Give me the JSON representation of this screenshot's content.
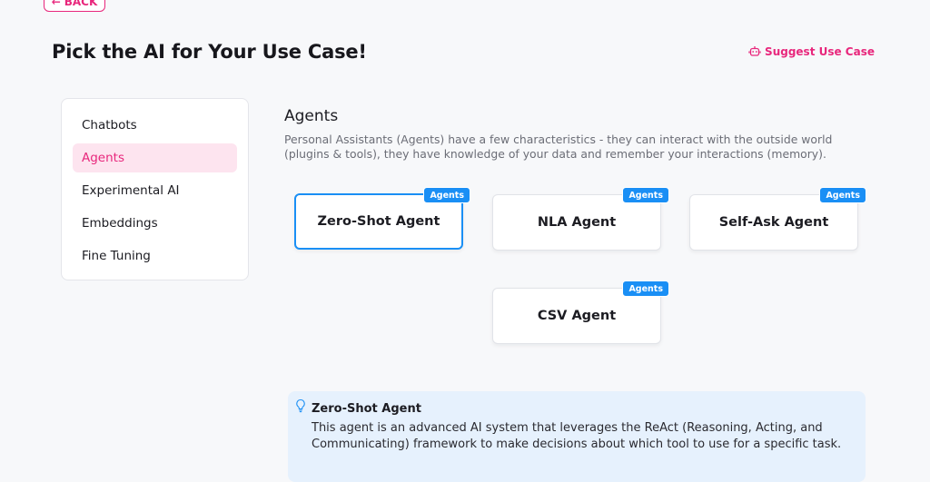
{
  "header": {
    "back_label": "BACK",
    "title": "Pick the AI for Your Use Case!",
    "suggest_label": "Suggest Use Case"
  },
  "sidebar": {
    "items": [
      {
        "label": "Chatbots",
        "active": false
      },
      {
        "label": "Agents",
        "active": true
      },
      {
        "label": "Experimental AI",
        "active": false
      },
      {
        "label": "Embeddings",
        "active": false
      },
      {
        "label": "Fine Tuning",
        "active": false
      }
    ]
  },
  "main": {
    "section_title": "Agents",
    "section_description": "Personal Assistants (Agents) have a few characteristics - they can interact with the outside world (plugins & tools), they have knowledge of your data and remember your interactions (memory).",
    "cards": [
      {
        "title": "Zero-Shot Agent",
        "badge": "Agents",
        "selected": true
      },
      {
        "title": "NLA Agent",
        "badge": "Agents",
        "selected": false
      },
      {
        "title": "Self-Ask Agent",
        "badge": "Agents",
        "selected": false
      },
      {
        "title": "CSV Agent",
        "badge": "Agents",
        "selected": false
      }
    ]
  },
  "info": {
    "title": "Zero-Shot Agent",
    "text": "This agent is an advanced AI system that leverages the ReAct (Reasoning, Acting, and Communicating) framework to make decisions about which tool to use for a specific task."
  },
  "colors": {
    "accent": "#e8277c",
    "accent_light": "#fde4ef",
    "selection_blue": "#1a8ff5",
    "info_bg": "#e6f1fd",
    "page_bg": "#f7f8fa"
  },
  "icons": {
    "back": "arrow-left-icon",
    "suggest": "robot-icon",
    "info": "lightbulb-icon"
  }
}
